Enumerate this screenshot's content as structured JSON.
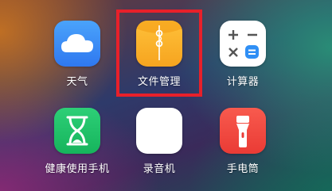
{
  "apps": [
    {
      "label": "天气",
      "icon": "cloud-icon",
      "color": "#3f8ef7"
    },
    {
      "label": "文件管理",
      "icon": "folder-icon",
      "color": "#f9b52a"
    },
    {
      "label": "计算器",
      "icon": "calculator-icon",
      "color": "#ffffff"
    },
    {
      "label": "健康使用手机",
      "icon": "hourglass-icon",
      "color": "#1fc066"
    },
    {
      "label": "录音机",
      "icon": "sound-wave-icon",
      "color": "#ffffff"
    },
    {
      "label": "手电筒",
      "icon": "flashlight-icon",
      "color": "#f0453f"
    }
  ],
  "highlight": {
    "target": "文件管理",
    "color": "#e8202a"
  }
}
